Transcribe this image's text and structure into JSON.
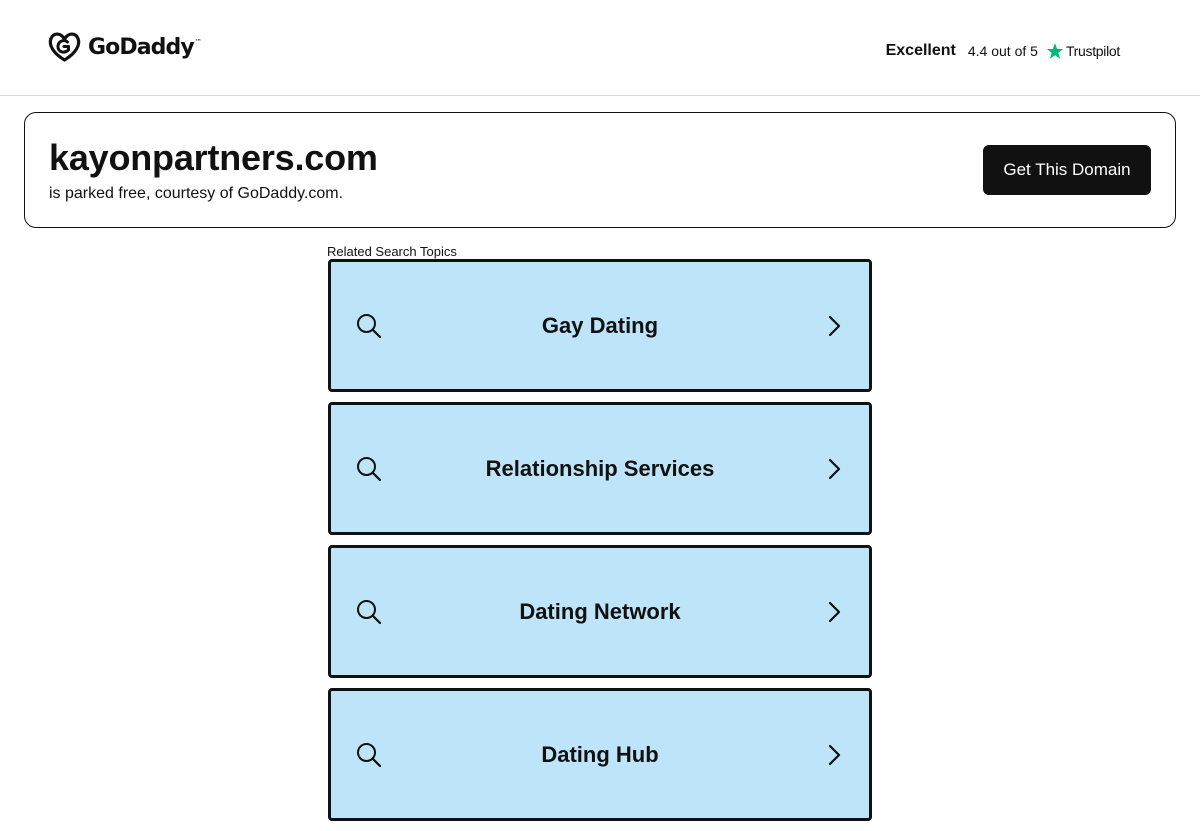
{
  "header": {
    "logo_text": "GoDaddy",
    "logo_tm": "™",
    "rating_label": "Excellent",
    "rating_score": "4.4 out of 5",
    "trustpilot_label": "Trustpilot"
  },
  "domain": {
    "name": "kayonpartners.com",
    "subtitle": "is parked free, courtesy of GoDaddy.com.",
    "cta_label": "Get This Domain"
  },
  "related": {
    "label": "Related Search Topics",
    "topics": [
      {
        "label": "Gay Dating"
      },
      {
        "label": "Relationship Services"
      },
      {
        "label": "Dating Network"
      },
      {
        "label": "Dating Hub"
      }
    ]
  },
  "colors": {
    "topic_background": "#bde4f8",
    "trustpilot_star": "#00b67a",
    "text": "#111111"
  },
  "icons": [
    "godaddy-logo-icon",
    "trustpilot-star-icon",
    "search-icon",
    "chevron-right-icon"
  ]
}
